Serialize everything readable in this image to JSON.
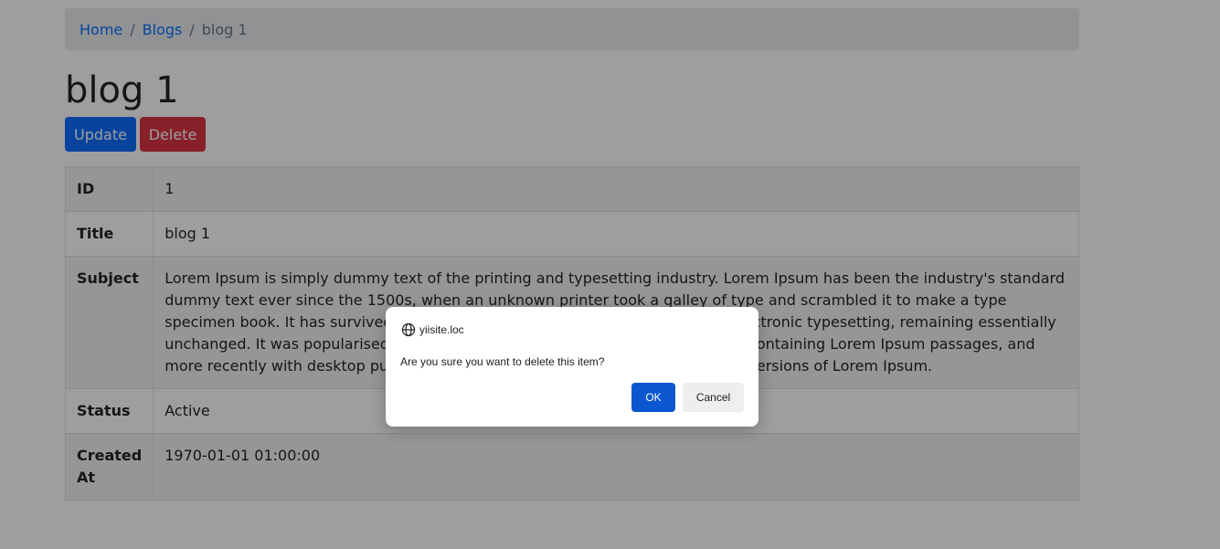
{
  "breadcrumb": {
    "items": [
      "Home",
      "Blogs"
    ],
    "active": "blog 1",
    "separator": "/"
  },
  "page": {
    "title": "blog 1"
  },
  "actions": {
    "update_label": "Update",
    "delete_label": "Delete"
  },
  "detail": {
    "rows": [
      {
        "label": "ID",
        "value": "1"
      },
      {
        "label": "Title",
        "value": "blog 1"
      },
      {
        "label": "Subject",
        "value": "Lorem Ipsum is simply dummy text of the printing and typesetting industry. Lorem Ipsum has been the industry's standard dummy text ever since the 1500s, when an unknown printer took a galley of type and scrambled it to make a type specimen book. It has survived not only five centuries, but also the leap into electronic typesetting, remaining essentially unchanged. It was popularised in the 1960s with the release of Letraset sheets containing Lorem Ipsum passages, and more recently with desktop publishing software like Aldus PageMaker including versions of Lorem Ipsum."
      },
      {
        "label": "Status",
        "value": "Active"
      },
      {
        "label": "Created At",
        "value": "1970-01-01 01:00:00"
      }
    ]
  },
  "dialog": {
    "origin": "yiisite.loc",
    "message": "Are you sure you want to delete this item?",
    "ok_label": "OK",
    "cancel_label": "Cancel"
  },
  "colors": {
    "primary": "#0d6efd",
    "danger": "#dc3545",
    "dialog_ok": "#0b57d0"
  },
  "icons": {
    "origin_icon": "globe-icon"
  }
}
